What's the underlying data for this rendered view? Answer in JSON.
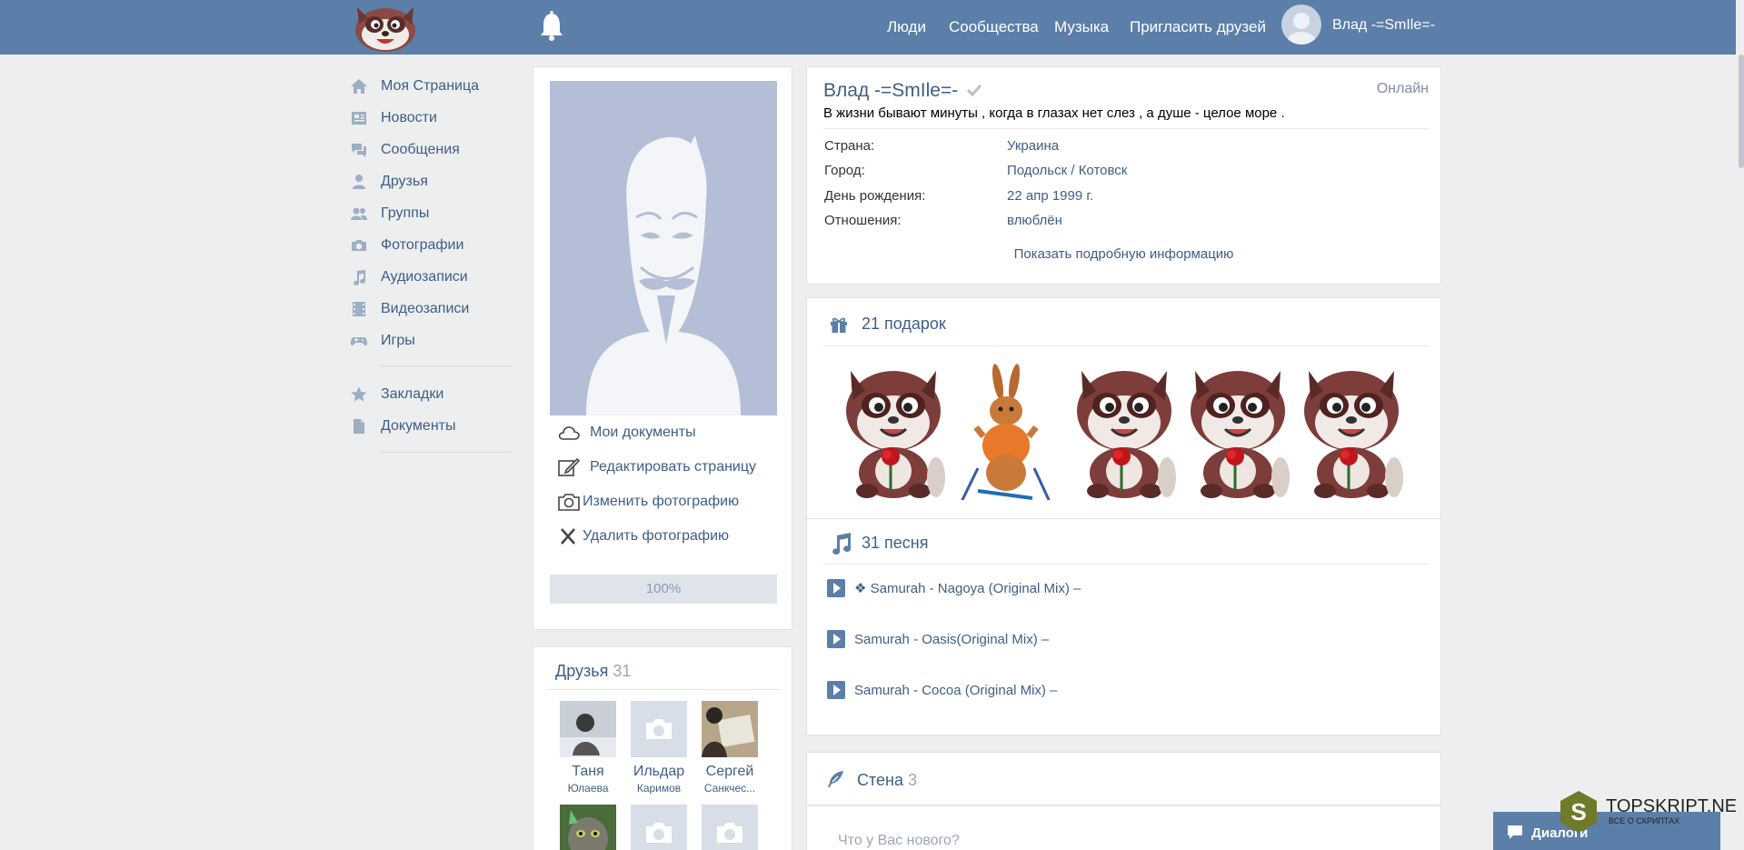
{
  "header": {
    "nav": [
      "Люди",
      "Сообщества",
      "Музыка",
      "Пригласить друзей"
    ],
    "user_name": "Влад -=SmIle=-"
  },
  "sidebar": {
    "items": [
      {
        "label": "Моя Страница",
        "icon": "home-icon"
      },
      {
        "label": "Новости",
        "icon": "news-icon"
      },
      {
        "label": "Сообщения",
        "icon": "messages-icon"
      },
      {
        "label": "Друзья",
        "icon": "friend-icon"
      },
      {
        "label": "Группы",
        "icon": "groups-icon"
      },
      {
        "label": "Фотографии",
        "icon": "camera-icon"
      },
      {
        "label": "Аудиозаписи",
        "icon": "music-note-icon"
      },
      {
        "label": "Видеозаписи",
        "icon": "film-icon"
      },
      {
        "label": "Игры",
        "icon": "gamepad-icon"
      }
    ],
    "extra": [
      {
        "label": "Закладки",
        "icon": "star-icon"
      },
      {
        "label": "Документы",
        "icon": "document-icon"
      }
    ]
  },
  "photo_card": {
    "actions": [
      "Мои документы",
      "Редактировать страницу",
      "Изменить фотографию",
      "Удалить фотографию"
    ],
    "progress_label": "100%",
    "progress_value": 1.0
  },
  "friends": {
    "title": "Друзья",
    "count": "31",
    "list": [
      {
        "first": "Таня",
        "last": "Юлаева"
      },
      {
        "first": "Ильдар",
        "last": "Каримов"
      },
      {
        "first": "Сергей",
        "last": "Санкчес..."
      }
    ]
  },
  "profile": {
    "name": "Влад -=SmIle=-",
    "online": "Онлайн",
    "status": "В жизни бывают минуты , когда в глазах нет слез , а душе - целое море .",
    "info": [
      {
        "label": "Страна:",
        "value": "Украина"
      },
      {
        "label": "Город:",
        "value": "Подольск / Котовск"
      },
      {
        "label": "День рождения:",
        "value": "22 апр 1999 г."
      },
      {
        "label": "Отношения:",
        "value": "влюблён"
      }
    ],
    "more_info": "Показать подробную информацию"
  },
  "gifts": {
    "title": "21 подарок"
  },
  "songs": {
    "title": "31 песня",
    "list": [
      "❖ Samurah - Nagoya (Original Mix) –",
      "Samurah - Oasis(Original Mix) –",
      "Samurah - Cocoa (Original Mix) –"
    ]
  },
  "wall": {
    "title": "Стена",
    "count": "3",
    "placeholder": "Что у Вас нового?"
  },
  "dialogs": {
    "label": "Диалоги"
  },
  "watermark": {
    "title": "TOPSKRIPT.NET",
    "subtitle": "ВСЕ О СКРИПТАХ",
    "letter": "S"
  },
  "colors": {
    "header": "#5b7fa8",
    "link": "#3f5e85",
    "background": "#edeef0"
  }
}
